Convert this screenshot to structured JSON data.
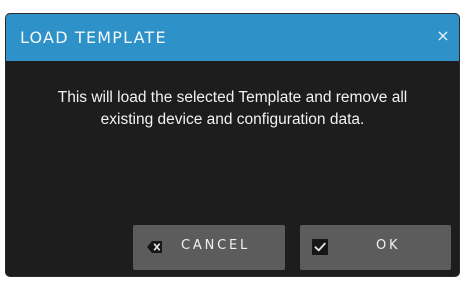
{
  "dialog": {
    "title": "LOAD TEMPLATE",
    "close_glyph": "×",
    "message_line1": "This will load the selected Template and remove all",
    "message_line2": "existing device and configuration data."
  },
  "buttons": {
    "cancel_label": "CANCEL",
    "cancel_icon": "backspace-x-icon",
    "ok_label": "OK",
    "ok_icon": "checkbox-check-icon"
  },
  "colors": {
    "titlebar": "#2e92c9",
    "dialog_bg": "#1d1d1d",
    "button_bg": "#5c5c5c",
    "text": "#f2f2f2"
  }
}
